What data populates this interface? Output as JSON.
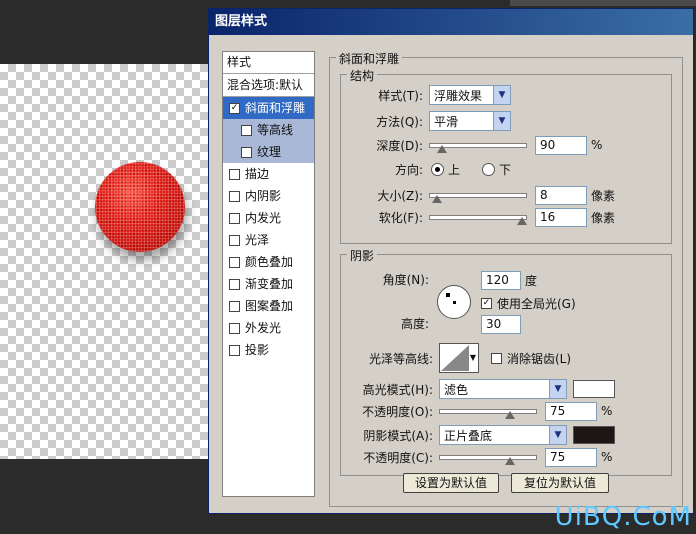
{
  "dialog": {
    "title": "图层样式"
  },
  "left_panel": {
    "header": "样式",
    "blend": "混合选项:默认",
    "items": [
      {
        "label": "斜面和浮雕",
        "checked": "✓"
      },
      {
        "label": "等高线",
        "checked": ""
      },
      {
        "label": "纹理",
        "checked": ""
      },
      {
        "label": "描边",
        "checked": ""
      },
      {
        "label": "内阴影",
        "checked": ""
      },
      {
        "label": "内发光",
        "checked": ""
      },
      {
        "label": "光泽",
        "checked": ""
      },
      {
        "label": "颜色叠加",
        "checked": ""
      },
      {
        "label": "渐变叠加",
        "checked": ""
      },
      {
        "label": "图案叠加",
        "checked": ""
      },
      {
        "label": "外发光",
        "checked": ""
      },
      {
        "label": "投影",
        "checked": ""
      }
    ]
  },
  "bevel": {
    "group_title": "斜面和浮雕",
    "structure_title": "结构",
    "style_label": "样式(T):",
    "style_value": "浮雕效果",
    "technique_label": "方法(Q):",
    "technique_value": "平滑",
    "depth_label": "深度(D):",
    "depth_value": "90",
    "depth_unit": "%",
    "depth_fraction": 0.09,
    "direction_label": "方向:",
    "direction_up": "上",
    "direction_down": "下",
    "size_label": "大小(Z):",
    "size_value": "8",
    "size_unit": "像素",
    "size_fraction": 0.03,
    "soften_label": "软化(F):",
    "soften_value": "16",
    "soften_unit": "像素",
    "soften_fraction": 1.0
  },
  "shading": {
    "title": "阴影",
    "angle_label": "角度(N):",
    "angle_value": "120",
    "angle_unit": "度",
    "global_light_label": "使用全局光(G)",
    "global_light_checked": "✓",
    "altitude_label": "高度:",
    "altitude_value": "30",
    "gloss_label": "光泽等高线:",
    "anti_alias_label": "消除锯齿(L)",
    "highlight_mode_label": "高光模式(H):",
    "highlight_mode_value": "滤色",
    "highlight_color": "#ffffff",
    "highlight_opacity_label": "不透明度(O):",
    "highlight_opacity_value": "75",
    "highlight_opacity_fraction": 0.75,
    "shadow_mode_label": "阴影模式(A):",
    "shadow_mode_value": "正片叠底",
    "shadow_color": "#1e1614",
    "shadow_opacity_label": "不透明度(C):",
    "shadow_opacity_value": "75",
    "shadow_opacity_fraction": 0.75,
    "percent": "%"
  },
  "buttons": {
    "set_default": "设置为默认值",
    "reset_default": "复位为默认值"
  },
  "watermark": "UiBQ.CoM"
}
